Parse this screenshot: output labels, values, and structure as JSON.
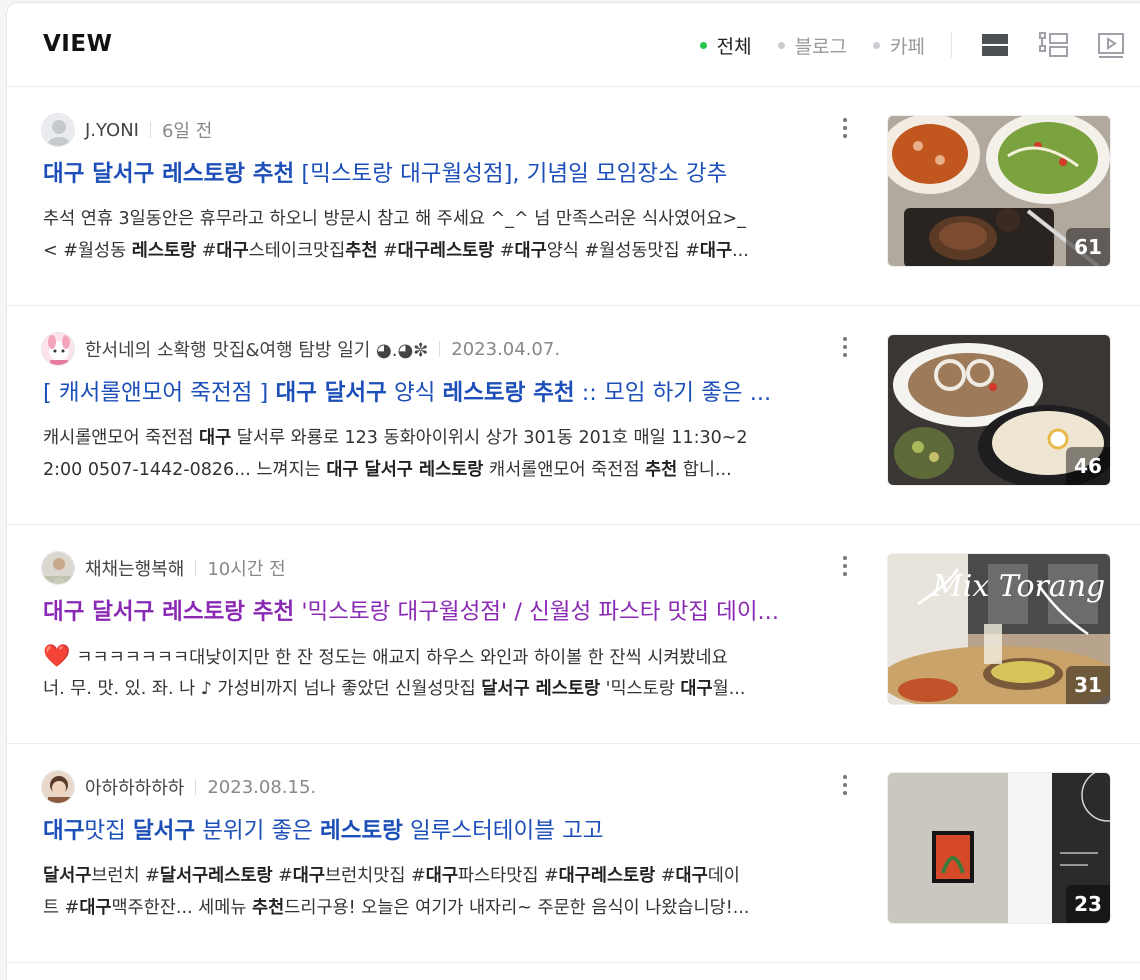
{
  "header": {
    "title": "VIEW",
    "filters": [
      {
        "label": "전체",
        "active": true
      },
      {
        "label": "블로그",
        "active": false
      },
      {
        "label": "카페",
        "active": false
      }
    ],
    "view_modes": [
      "list-view-icon",
      "thumbnail-list-icon",
      "video-icon"
    ]
  },
  "colors": {
    "accent_dot": "#26c34d",
    "link": "#1d4fb8",
    "visited_link": "#8a2ab4"
  },
  "results": [
    {
      "author": "J.YONI",
      "date": "6일 전",
      "title": [
        {
          "t": "대구 달서구 레스토랑 추천",
          "b": true
        },
        {
          "t": " [믹스토랑 대구월성점], 기념일 모임장소 강추",
          "b": false
        }
      ],
      "visited": false,
      "snippet_lines": [
        [
          {
            "t": "추석 연휴 3일동안은 휴무라고 하오니 방문시 참고 해 주세요 ^_^ 넘 만족스러운 식사였어요>_",
            "b": false
          }
        ],
        [
          {
            "t": "< #월성동 ",
            "b": false
          },
          {
            "t": "레스토랑",
            "b": true
          },
          {
            "t": " #",
            "b": false
          },
          {
            "t": "대구",
            "b": true
          },
          {
            "t": "스테이크맛집",
            "b": false
          },
          {
            "t": "추천",
            "b": true
          },
          {
            "t": " #",
            "b": false
          },
          {
            "t": "대구레스토랑",
            "b": true
          },
          {
            "t": " #",
            "b": false
          },
          {
            "t": "대구",
            "b": true
          },
          {
            "t": "양식 #월성동맛집 #",
            "b": false
          },
          {
            "t": "대구",
            "b": true
          },
          {
            "t": "...",
            "b": false
          }
        ]
      ],
      "image_count": "61"
    },
    {
      "author": "한서네의 소확행 맛집&여행 탐방 일기 ◕.◕✼",
      "date": "2023.04.07.",
      "title": [
        {
          "t": "[ 캐서롤앤모어 죽전점 ] ",
          "b": false
        },
        {
          "t": "대구 달서구",
          "b": true
        },
        {
          "t": " 양식 ",
          "b": false
        },
        {
          "t": "레스토랑 추천",
          "b": true
        },
        {
          "t": " :: 모임 하기 좋은 ...",
          "b": false
        }
      ],
      "visited": false,
      "snippet_lines": [
        [
          {
            "t": "캐시롤앤모어 죽전점 ",
            "b": false
          },
          {
            "t": "대구",
            "b": true
          },
          {
            "t": " 달서루 와룡로 123 동화아이위시 상가 301동 201호 매일 11:30~2",
            "b": false
          }
        ],
        [
          {
            "t": "2:00 0507-1442-0826... 느껴지는 ",
            "b": false
          },
          {
            "t": "대구 달서구 레스토랑",
            "b": true
          },
          {
            "t": " 캐서롤앤모어 죽전점 ",
            "b": false
          },
          {
            "t": "추천",
            "b": true
          },
          {
            "t": " 합니...",
            "b": false
          }
        ]
      ],
      "image_count": "46"
    },
    {
      "author": "채채는행복해",
      "date": "10시간 전",
      "title": [
        {
          "t": "대구 달서구 레스토랑 추천",
          "b": true
        },
        {
          "t": " '믹스토랑 대구월성점' / 신월성 파스타 맛집 데이...",
          "b": false
        }
      ],
      "visited": true,
      "snippet_lines": [
        [
          {
            "t": "❤️",
            "b": false,
            "heart": true
          },
          {
            "t": "ㅋㅋㅋㅋㅋㅋㅋ대낮이지만 한 잔 정도는 애교지 하우스 와인과 하이볼 한 잔씩 시켜봤네요",
            "b": false
          }
        ],
        [
          {
            "t": "너. 무. 맛. 있. 좌. 나 ♪ 가성비까지 넘나 좋았던 신월성맛집 ",
            "b": false
          },
          {
            "t": "달서구 레스토랑",
            "b": true
          },
          {
            "t": " '믹스토랑 ",
            "b": false
          },
          {
            "t": "대구",
            "b": true
          },
          {
            "t": "월...",
            "b": false
          }
        ]
      ],
      "image_overlay_text": "Mix Torang",
      "image_count": "31"
    },
    {
      "author": "아하하하하하",
      "date": "2023.08.15.",
      "title": [
        {
          "t": "대구",
          "b": true
        },
        {
          "t": "맛집 ",
          "b": false
        },
        {
          "t": "달서구",
          "b": true
        },
        {
          "t": " 분위기 좋은 ",
          "b": false
        },
        {
          "t": "레스토랑",
          "b": true
        },
        {
          "t": " 일루스터테이블 고고",
          "b": false
        }
      ],
      "visited": false,
      "snippet_lines": [
        [
          {
            "t": "달서구",
            "b": true
          },
          {
            "t": "브런치 #",
            "b": false
          },
          {
            "t": "달서구레스토랑",
            "b": true
          },
          {
            "t": " #",
            "b": false
          },
          {
            "t": "대구",
            "b": true
          },
          {
            "t": "브런치맛집 #",
            "b": false
          },
          {
            "t": "대구",
            "b": true
          },
          {
            "t": "파스타맛집 #",
            "b": false
          },
          {
            "t": "대구레스토랑",
            "b": true
          },
          {
            "t": " #",
            "b": false
          },
          {
            "t": "대구",
            "b": true
          },
          {
            "t": "데이",
            "b": false
          }
        ],
        [
          {
            "t": "트 #",
            "b": false
          },
          {
            "t": "대구",
            "b": true
          },
          {
            "t": "맥주한잔... 세메뉴 ",
            "b": false
          },
          {
            "t": "추천",
            "b": true
          },
          {
            "t": "드리구용! 오늘은 여기가 내자리~ 주문한 음식이 나왔습니당!...",
            "b": false
          }
        ]
      ],
      "image_count": "23"
    }
  ]
}
